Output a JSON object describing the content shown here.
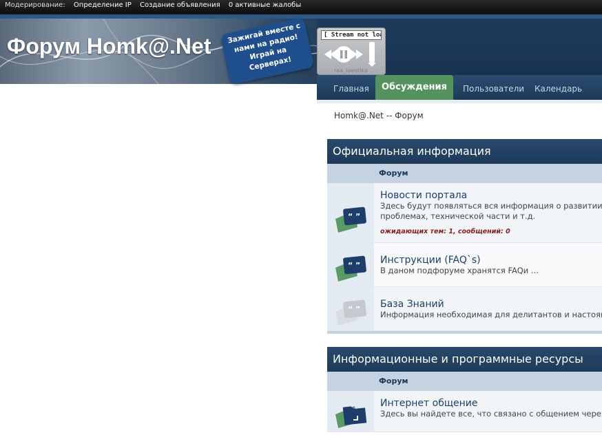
{
  "modbar": {
    "label": "Модерирование:",
    "links": [
      "Определение IP",
      "Создание объявления",
      "0 активные жалобы"
    ]
  },
  "header": {
    "logo": "Форум Homk@.Net",
    "bubble_lines": [
      "Зажигай вместе с",
      "нами на радио!",
      "Играй на Серверах!"
    ]
  },
  "player": {
    "stream_status": "[ Stream not loaded ]",
    "site": "raa_laeotika"
  },
  "nav": {
    "items": [
      "Главная",
      "Обсуждения",
      "Пользователи",
      "Календарь"
    ],
    "active": "Обсуждения"
  },
  "breadcrumb": "Homk@.Net -- Форум",
  "categories": [
    {
      "title": "Официальная информация",
      "column": "Форум",
      "forums": [
        {
          "name": "Новости портала",
          "desc_lines": [
            "Здесь будут появляться вся информация о развитии пор",
            "проблемах, технической части и т.д."
          ],
          "pending": "ожидающих тем: 1, сообщений: 0",
          "icon": "forum-speech-bubble-icon"
        },
        {
          "name": "Инструкции (FAQ`s)",
          "desc_lines": [
            "В даном подфоруме хранятся FAQи ..."
          ],
          "icon": "forum-speech-bubble-icon"
        },
        {
          "name": "База Знаний",
          "desc_lines": [
            "Информация необходимая для делитантов и настоящих"
          ],
          "icon": "forum-speech-bubble-inactive-icon"
        }
      ]
    },
    {
      "title": "Информационные и программные ресурсы",
      "column": "Форум",
      "forums": [
        {
          "name": "Интернет общение",
          "desc_lines": [
            "Здесь вы найдете все, что связано с общением через ин"
          ],
          "icon": "forum-folder-icon"
        }
      ]
    }
  ],
  "colors": {
    "nav_active": "#54925e",
    "category_header": "#1d3a58",
    "forum_link": "#1d3f6b",
    "pending_text": "#8b1c1c"
  }
}
